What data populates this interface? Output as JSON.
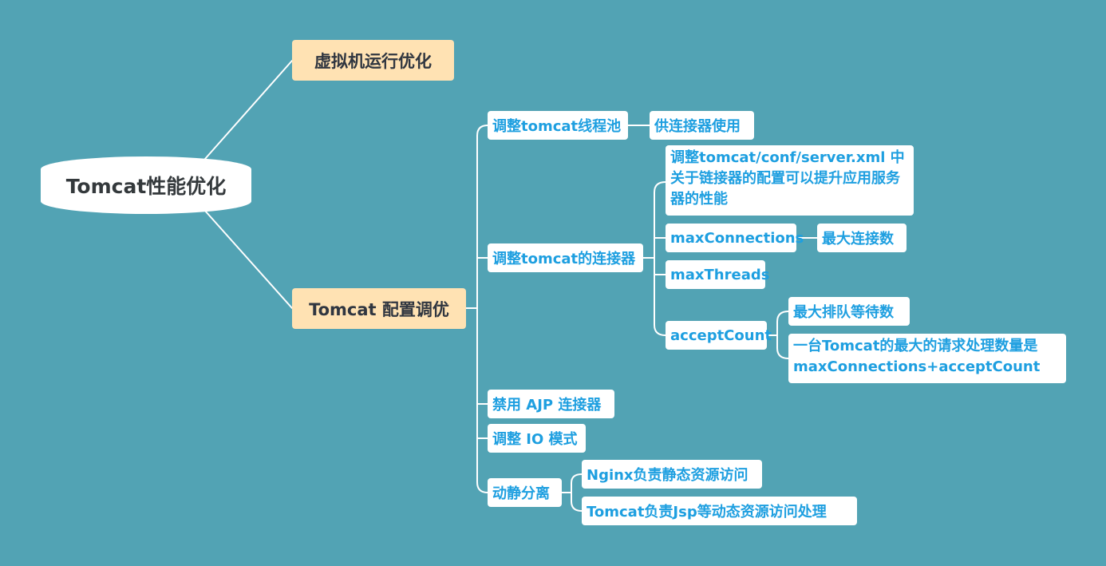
{
  "root": "Tomcat性能优化",
  "branch_vm": "虚拟机运行优化",
  "branch_config": "Tomcat 配置调优",
  "config": {
    "threadpool": "调整tomcat线程池",
    "threadpool_note": "供连接器使用",
    "connector": "调整tomcat的连接器",
    "connector_desc": "调整tomcat/conf/server.xml 中关于链接器的配置可以提升应用服务器的性能",
    "max_connections": "maxConnections",
    "max_connections_note": "最大连接数",
    "max_threads": "maxThreads",
    "accept_count": "acceptCount",
    "accept_count_note1": "最大排队等待数",
    "accept_count_note2": "一台Tomcat的最大的请求处理数量是maxConnections+acceptCount",
    "disable_ajp": "禁用 AJP 连接器",
    "io_mode": "调整 IO 模式",
    "separation": "动静分离",
    "nginx_note": "Nginx负责静态资源访问",
    "tomcat_note": "Tomcat负责Jsp等动态资源访问处理"
  },
  "colors": {
    "background": "#52a3b4",
    "line": "#ffffff",
    "main_fill": "#ffe2b3",
    "sub_text": "#1e9fe0"
  }
}
